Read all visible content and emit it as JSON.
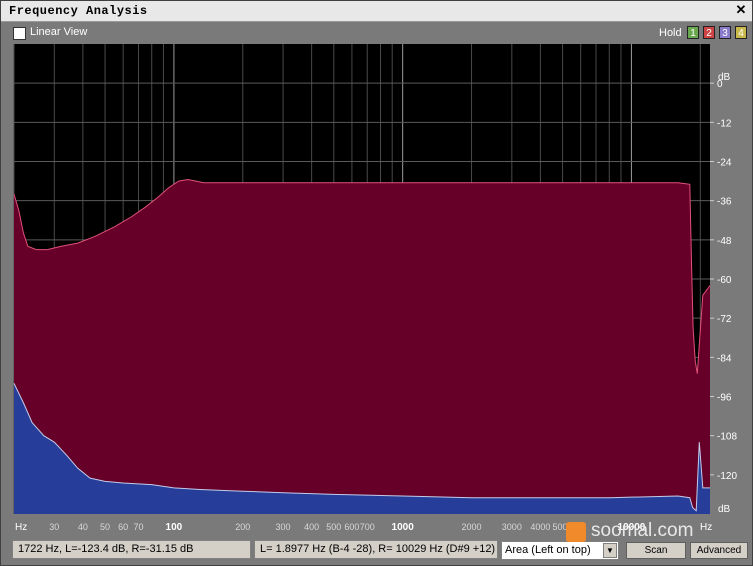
{
  "window": {
    "title": "Frequency Analysis",
    "close_glyph": "✕"
  },
  "toolbar": {
    "linear_view_label": "Linear View",
    "linear_view_checked": false,
    "hold_label": "Hold",
    "hold_buttons": [
      {
        "label": "1",
        "color": "#6aa84f"
      },
      {
        "label": "2",
        "color": "#cc4444"
      },
      {
        "label": "3",
        "color": "#8a7acc"
      },
      {
        "label": "4",
        "color": "#c9b84a"
      }
    ]
  },
  "chart_data": {
    "type": "area",
    "xscale": "log",
    "xlim": [
      20,
      22050
    ],
    "ylim": [
      -132,
      12
    ],
    "grid": true,
    "xlabel": "Hz",
    "ylabel": "dB",
    "x_tick_labels": [
      {
        "value": 30,
        "label": "30"
      },
      {
        "value": 40,
        "label": "40"
      },
      {
        "value": 50,
        "label": "50"
      },
      {
        "value": 60,
        "label": "60"
      },
      {
        "value": 70,
        "label": "70"
      },
      {
        "value": 100,
        "label": "100"
      },
      {
        "value": 200,
        "label": "200"
      },
      {
        "value": 300,
        "label": "300"
      },
      {
        "value": 400,
        "label": "400"
      },
      {
        "value": 500,
        "label": "500"
      },
      {
        "value": 600,
        "label": "600"
      },
      {
        "value": 700,
        "label": "700"
      },
      {
        "value": 1000,
        "label": "1000"
      },
      {
        "value": 2000,
        "label": "2000"
      },
      {
        "value": 3000,
        "label": "3000"
      },
      {
        "value": 4000,
        "label": "4000"
      },
      {
        "value": 5000,
        "label": "5000"
      },
      {
        "value": 10000,
        "label": "10000"
      }
    ],
    "y_ticks": [
      0,
      -12,
      -24,
      -36,
      -48,
      -60,
      -72,
      -84,
      -96,
      -108,
      -120
    ],
    "series": [
      {
        "color": "#660028",
        "stroke": "#e2507a",
        "points": [
          [
            20,
            -34
          ],
          [
            21,
            -39
          ],
          [
            22,
            -46
          ],
          [
            23,
            -50
          ],
          [
            25,
            -51
          ],
          [
            28,
            -51
          ],
          [
            32,
            -50
          ],
          [
            38,
            -49
          ],
          [
            45,
            -47
          ],
          [
            55,
            -44
          ],
          [
            65,
            -41
          ],
          [
            75,
            -38
          ],
          [
            85,
            -35
          ],
          [
            95,
            -32
          ],
          [
            105,
            -30
          ],
          [
            115,
            -29.5
          ],
          [
            125,
            -30
          ],
          [
            135,
            -30.5
          ],
          [
            160,
            -30.5
          ],
          [
            500,
            -30.5
          ],
          [
            2000,
            -30.5
          ],
          [
            8000,
            -30.5
          ],
          [
            16000,
            -30.5
          ],
          [
            18000,
            -31
          ],
          [
            18300,
            -55
          ],
          [
            18600,
            -75
          ],
          [
            19000,
            -85
          ],
          [
            19400,
            -89
          ],
          [
            19800,
            -80
          ],
          [
            20500,
            -65
          ],
          [
            22050,
            -62
          ]
        ]
      },
      {
        "color": "#263e9a",
        "stroke": "#c4cbe8",
        "points": [
          [
            20,
            -92
          ],
          [
            22,
            -98
          ],
          [
            24,
            -104
          ],
          [
            27,
            -108
          ],
          [
            30,
            -110
          ],
          [
            34,
            -114
          ],
          [
            38,
            -118
          ],
          [
            43,
            -121
          ],
          [
            50,
            -122
          ],
          [
            60,
            -122.5
          ],
          [
            80,
            -123
          ],
          [
            100,
            -124
          ],
          [
            130,
            -124.5
          ],
          [
            200,
            -125
          ],
          [
            300,
            -125.5
          ],
          [
            500,
            -126
          ],
          [
            1000,
            -126.5
          ],
          [
            2000,
            -127
          ],
          [
            4000,
            -127
          ],
          [
            8000,
            -127
          ],
          [
            16000,
            -126.5
          ],
          [
            18000,
            -127
          ],
          [
            18500,
            -130
          ],
          [
            19200,
            -131
          ],
          [
            19800,
            -110
          ],
          [
            20500,
            -124
          ],
          [
            22050,
            -124
          ]
        ]
      }
    ]
  },
  "status": {
    "cursor_readout": "1722 Hz, L=-123.4 dB, R=-31.15 dB",
    "peak_readout": "L= 1.8977 Hz (B-4 -28), R=  10029 Hz (D#9 +12)",
    "view_mode": "Area (Left on top)"
  },
  "buttons": {
    "scan": "Scan",
    "advanced": "Advanced"
  },
  "watermark": {
    "text": "soomal.com"
  }
}
